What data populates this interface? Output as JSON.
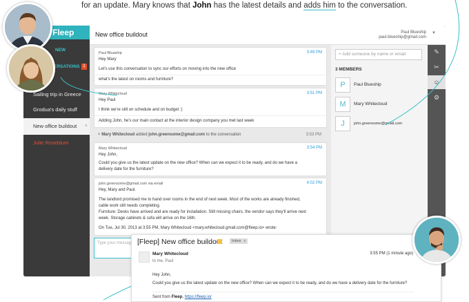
{
  "intro": {
    "part1": "for an update. Mary knows that ",
    "bold": "John",
    "part2": " has the latest details and ",
    "underlined": "adds him",
    "part3": " to the conversation."
  },
  "sidebar": {
    "brand": "Fleep",
    "new_label": "NEW",
    "convs_label": "ERSATIONS",
    "convs_badge": "1",
    "items": [
      {
        "label": "Sailing trip in Greece"
      },
      {
        "label": "Grodua's daily stuff"
      },
      {
        "label": "New office buildout",
        "close": "×"
      },
      {
        "label": "Julie Roseblum"
      }
    ]
  },
  "chat": {
    "title": "New office buildout",
    "me_name": "Paul Blueship",
    "me_email": "paul.blueship@gmail.com",
    "menu_caret": "▼",
    "messages": [
      {
        "sender": "Paul Bluaship",
        "time": "3:49 PM",
        "lines": [
          "Hey Mary",
          "Let's use this conversation to sync our efforts on moving into the new office",
          "what's the latest on rooms and furniture?"
        ]
      },
      {
        "sender": "Mary Whitecloud",
        "time": "3:51 PM",
        "lines": [
          "Hey Paul",
          "I think we're still on schedule and on budget :)",
          "Adding John, he's our main contact at the interior design company you met last week"
        ]
      },
      {
        "sender": "Mary Whitecloud",
        "time": "3:54 PM",
        "lines": [
          "Hey John,",
          "Could you give us the latest update on the new office? When can we expect it to be ready, and do we have a",
          "delivery date for the furniture?"
        ]
      },
      {
        "sender": "john.greensome@gmail.com via email",
        "time": "4:02 PM",
        "lines": [
          "Hey, Mary and Paul.",
          "The landlord promised me to hand over rooms in the end of next week. Most of the works are already finished,",
          "cable work still needs completing.",
          "Furniture: Desks have arrived and are ready for installation. Still missing chairs, the vendor says they'll arrive next",
          "week. Storage cabinets & sofa will arrive on the 16th.",
          "On Tue, Jul 30, 2013 at 3:55 PM, Mary Whitecloud <mary.whitecloud.gmail.com@fleep.io> wrote:"
        ]
      }
    ],
    "event": {
      "icon": "+",
      "actor": "Mary Whitecloud",
      "text": "added",
      "target": "john.greensome@gmail.com",
      "suffix": "to the conversation",
      "time": "3:53 PM"
    },
    "composer_placeholder": "Type your message"
  },
  "members_panel": {
    "add_placeholder": "+ Add someone by name or email",
    "title": "3 MEMBERS",
    "members": [
      {
        "initial": "P",
        "name": "Paul Blueship"
      },
      {
        "initial": "M",
        "name": "Mary Whitecloud"
      },
      {
        "initial": "J",
        "name": "john.greensome@gmail.com"
      }
    ]
  },
  "tools": [
    {
      "icon": "pin-icon",
      "glyph": "✎"
    },
    {
      "icon": "paperclip-icon",
      "glyph": "✂"
    },
    {
      "icon": "members-icon",
      "glyph": "☺"
    },
    {
      "icon": "gear-icon",
      "glyph": "⚙"
    }
  ],
  "email": {
    "subject": "[Fleep] New office buildout",
    "inbox_tag": "Inbox",
    "inbox_close": "x",
    "from": "Mary Whitecloud",
    "to": "to me, Paul",
    "time": "3:55 PM (1 minute ago)",
    "star": "☆",
    "greeting": "Hey John,",
    "body": "Could you give us the latest update on the new office? When can we expect it to be ready, and do we have a delivery date for the furniture?",
    "sent_prefix": "Sent from",
    "sent_brand": "Fleep",
    "sent_link": "https://fleep.io/"
  },
  "colors": {
    "accent": "#39c0c8",
    "time_blue": "#2a9bd6",
    "badge_red": "#e04f2c",
    "sidebar_dark": "#3a3a3a"
  }
}
